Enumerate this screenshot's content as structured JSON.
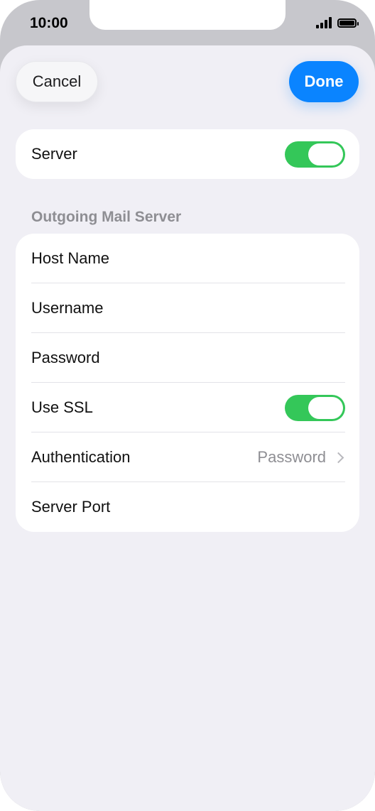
{
  "status_bar": {
    "time": "10:00"
  },
  "nav": {
    "cancel_label": "Cancel",
    "done_label": "Done"
  },
  "server_row": {
    "label": "Server",
    "toggle_on": true
  },
  "outgoing": {
    "header": "Outgoing Mail Server",
    "rows": {
      "host_name": "Host Name",
      "username": "Username",
      "password": "Password",
      "use_ssl": "Use SSL",
      "authentication": "Authentication",
      "authentication_value": "Password",
      "server_port": "Server Port"
    },
    "use_ssl_on": true
  },
  "colors": {
    "accent": "#0a84ff",
    "toggle_on": "#34c759",
    "background": "#f0eff5"
  }
}
